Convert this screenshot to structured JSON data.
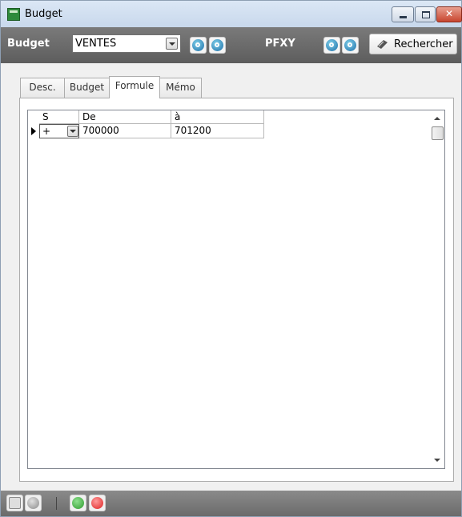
{
  "window": {
    "title": "Budget",
    "controls": [
      "minimize",
      "maximize",
      "close"
    ]
  },
  "toolbar": {
    "budget_label": "Budget",
    "budget_value": "VENTES",
    "pfxy_label": "PFXY",
    "search_label": "Rechercher",
    "accent_color": "#5d5d5d"
  },
  "tabs": [
    {
      "label": "Desc.",
      "active": false
    },
    {
      "label": "Budget",
      "active": false
    },
    {
      "label": "Formule",
      "active": true
    },
    {
      "label": "Mémo",
      "active": false
    }
  ],
  "grid": {
    "columns": [
      "S",
      "De",
      "à"
    ],
    "rows": [
      {
        "sign": "+",
        "from": "700000",
        "to": "701200"
      }
    ]
  },
  "bottom": {
    "buttons": [
      "save-icon",
      "refresh-icon",
      "ok-icon",
      "cancel-icon"
    ]
  }
}
